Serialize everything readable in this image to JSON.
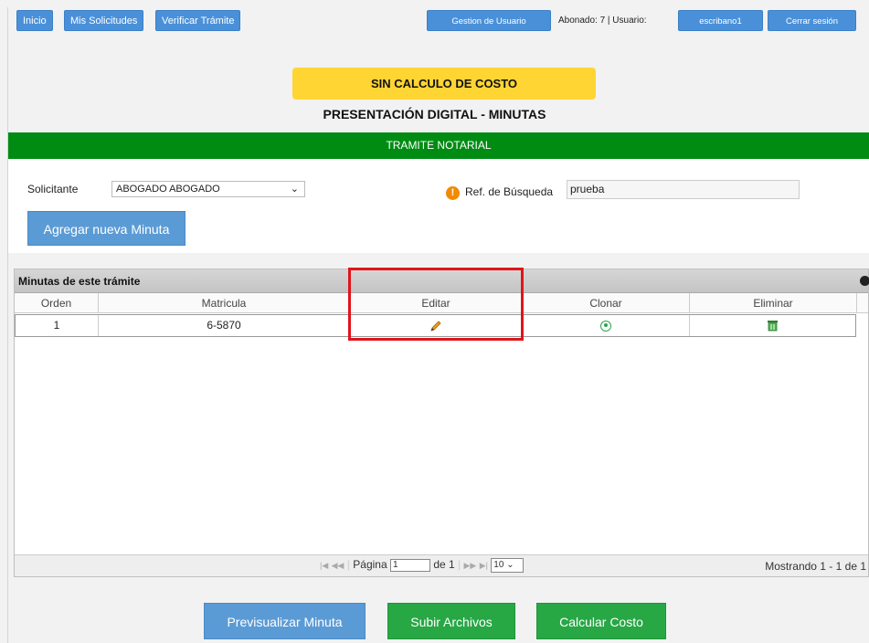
{
  "nav": {
    "inicio": "Inicio",
    "mis_solicitudes": "Mis Solicitudes",
    "verificar_tramite": "Verificar Trámite",
    "gestion_usuario": "Gestion de Usuario",
    "abonado_info": "Abonado: 7 | Usuario:",
    "username": "escribano1",
    "cerrar_sesion": "Cerrar sesión"
  },
  "banner": {
    "cost_status": "SIN CALCULO DE COSTO",
    "subtitle": "PRESENTACIÓN DIGITAL - MINUTAS",
    "section": "TRAMITE NOTARIAL"
  },
  "form": {
    "solicitante_label": "Solicitante",
    "solicitante_value": "ABOGADO ABOGADO",
    "ref_label": "Ref. de Búsqueda",
    "ref_value": "prueba",
    "add_button": "Agregar nueva Minuta"
  },
  "grid": {
    "caption": "Minutas de este trámite",
    "columns": [
      "Orden",
      "Matricula",
      "Editar",
      "Clonar",
      "Eliminar"
    ],
    "rows": [
      {
        "orden": "1",
        "matricula": "6-5870"
      }
    ],
    "pager": {
      "page_label": "Página",
      "page_value": "1",
      "of_label": "de 1",
      "page_size": "10",
      "summary": "Mostrando 1 - 1 de 1"
    }
  },
  "actions": {
    "preview": "Previsualizar Minuta",
    "upload": "Subir Archivos",
    "calculate": "Calcular Costo"
  },
  "colors": {
    "nav_blue": "#4a90d9",
    "banner_yellow": "#ffd534",
    "section_green": "#008c13",
    "highlight_red": "#e0141b"
  }
}
